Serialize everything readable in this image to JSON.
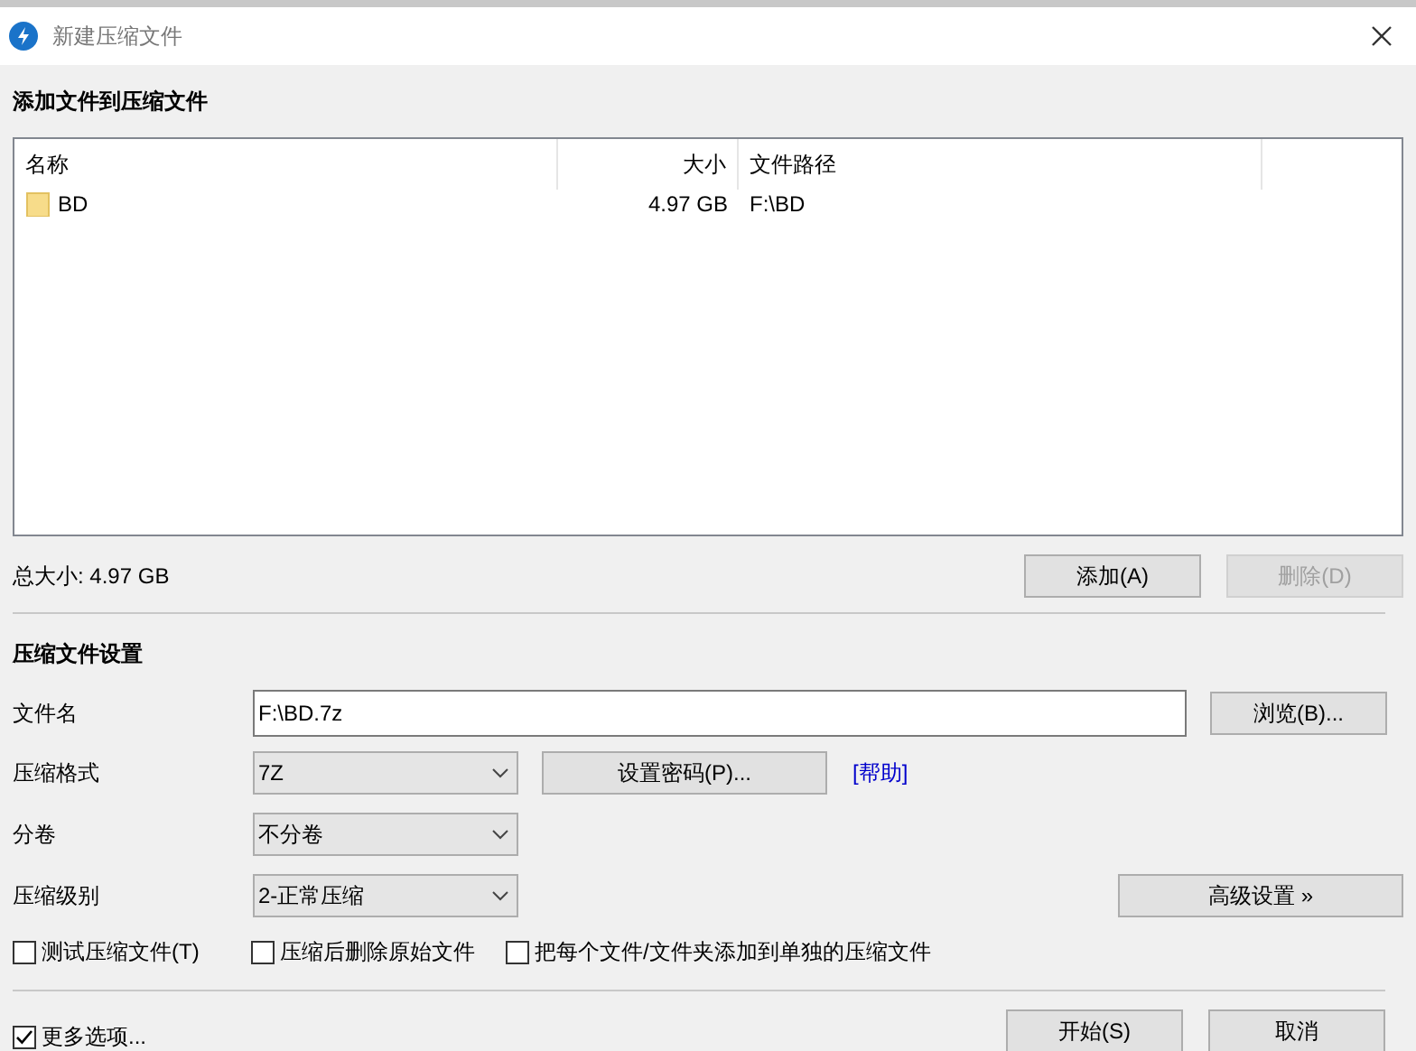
{
  "window": {
    "title": "新建压缩文件"
  },
  "file_section": {
    "heading": "添加文件到压缩文件",
    "columns": [
      "名称",
      "大小",
      "文件路径"
    ],
    "rows": [
      {
        "name": "BD",
        "size": "4.97 GB",
        "path": "F:\\BD"
      }
    ],
    "total": "总大小: 4.97 GB",
    "buttons": [
      {
        "label": "添加(A)",
        "disabled": false
      },
      {
        "label": "删除(D)",
        "disabled": true
      }
    ]
  },
  "settings": {
    "heading": "压缩文件设置",
    "filename": {
      "label": "文件名",
      "value": "F:\\BD.7z",
      "button": "浏览(B)..."
    },
    "format": {
      "label": "压缩格式",
      "value": "7Z",
      "button": "设置密码(P)...",
      "link": "[帮助]"
    },
    "split": {
      "label": "分卷",
      "value": "不分卷"
    },
    "level": {
      "label": "压缩级别",
      "value": "2-正常压缩",
      "button": "高级设置 »"
    },
    "options": [
      {
        "label": "测试压缩文件(T)",
        "checked": false
      },
      {
        "label": "压缩后删除原始文件",
        "checked": false
      },
      {
        "label": "把每个文件/文件夹添加到单独的压缩文件",
        "checked": false
      }
    ]
  },
  "footer": {
    "more": {
      "label": "更多选项...",
      "checked": true
    },
    "buttons": [
      "开始(S)",
      "取消"
    ]
  }
}
